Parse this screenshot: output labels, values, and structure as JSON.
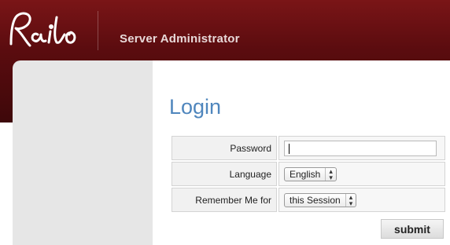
{
  "header": {
    "logo_text": "Railo",
    "app_title": "Server Administrator"
  },
  "main": {
    "title": "Login",
    "form": {
      "password_label": "Password",
      "password_value": "",
      "language_label": "Language",
      "language_selected": "English",
      "remember_label": "Remember Me for",
      "remember_selected": "this Session",
      "submit_label": "submit"
    }
  },
  "colors": {
    "header_dark_red": "#5b0c0f",
    "title_blue": "#4f86bd",
    "sidebar_gray": "#e6e6e6"
  }
}
